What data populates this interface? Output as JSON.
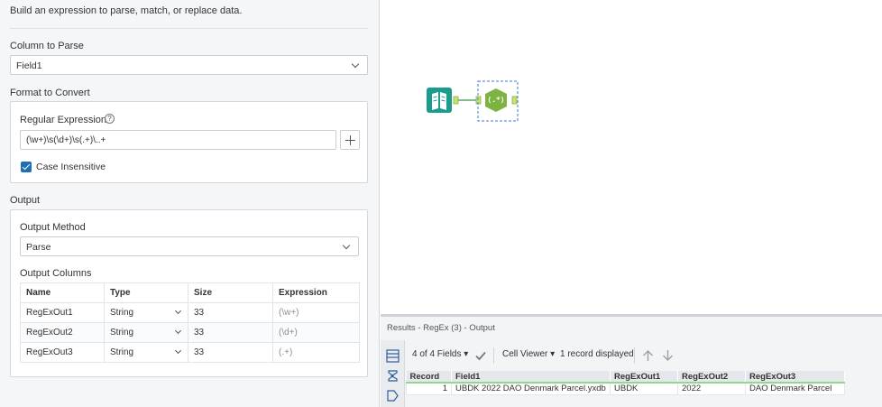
{
  "config": {
    "description": "Build an expression to parse, match, or replace data.",
    "column_to_parse_label": "Column to Parse",
    "column_to_parse_value": "Field1",
    "format_label": "Format to Convert",
    "regex_label": "Regular Expression",
    "regex_value": "(\\w+)\\s(\\d+)\\s(.+)\\..+",
    "case_insensitive_label": "Case Insensitive",
    "case_insensitive_checked": true,
    "output_label": "Output",
    "output_method_label": "Output Method",
    "output_method_value": "Parse",
    "output_columns_label": "Output Columns",
    "columns_headers": [
      "Name",
      "Type",
      "Size",
      "Expression"
    ],
    "columns_rows": [
      {
        "name": "RegExOut1",
        "type": "String",
        "size": "33",
        "expression": "(\\w+)"
      },
      {
        "name": "RegExOut2",
        "type": "String",
        "size": "33",
        "expression": "(\\d+)"
      },
      {
        "name": "RegExOut3",
        "type": "String",
        "size": "33",
        "expression": "(.+)"
      }
    ],
    "accent_color": "#1f6fb5"
  },
  "canvas": {
    "input_tool_icon": "book-icon",
    "regex_tool_icon": "regex-hexagon-icon",
    "regex_tool_glyph": "(.*)",
    "input_tool_color": "#1a9b8c",
    "regex_tool_color": "#7cb342"
  },
  "results": {
    "title": "Results - RegEx (3) - Output",
    "fields_label": "4 of 4 Fields",
    "cell_viewer_label": "Cell Viewer",
    "records_label": "1 record displayed",
    "headers": [
      "Record",
      "Field1",
      "RegExOut1",
      "RegExOut2",
      "RegExOut3"
    ],
    "rows": [
      {
        "record": "1",
        "field1": "UBDK 2022 DAO Denmark Parcel.yxdb",
        "out1": "UBDK",
        "out2": "2022",
        "out3": "DAO Denmark Parcel"
      }
    ]
  }
}
